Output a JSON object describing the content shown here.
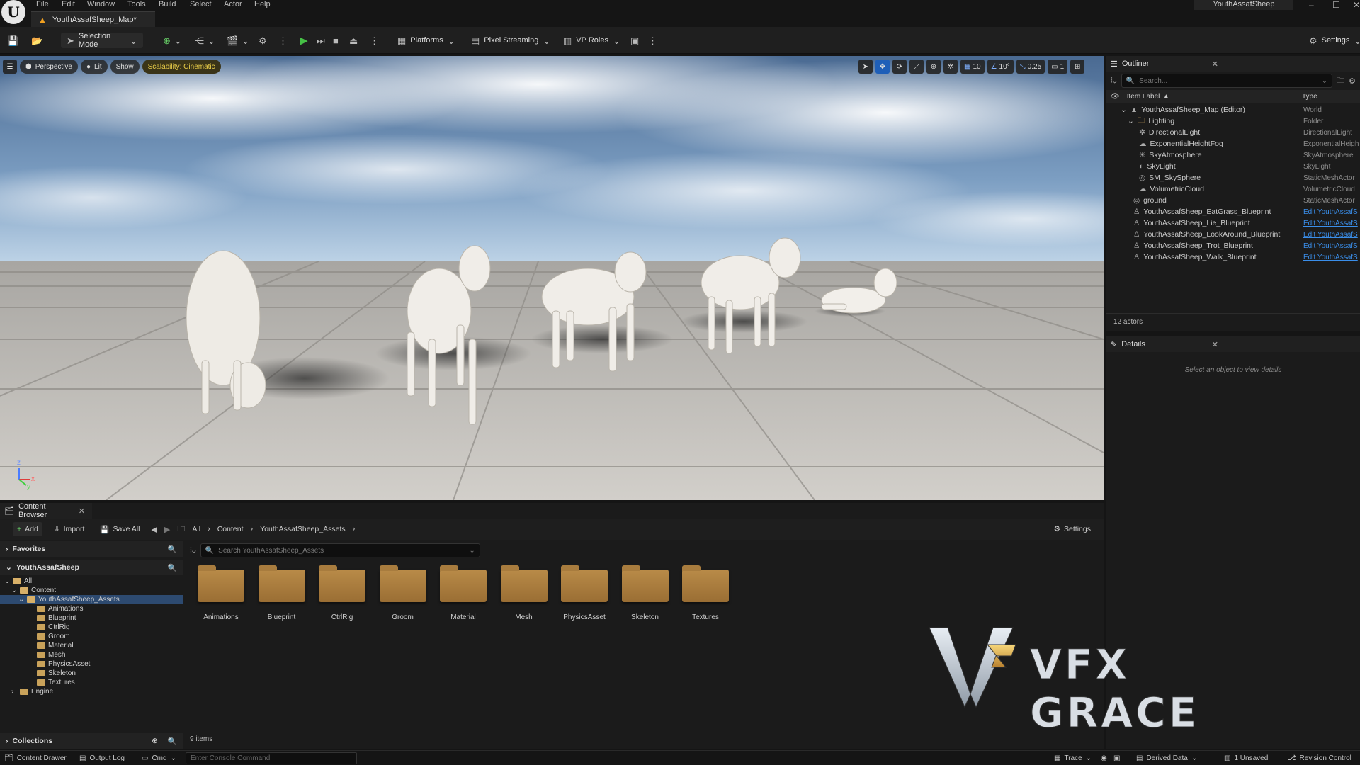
{
  "app": {
    "logo": "U"
  },
  "menu": [
    "File",
    "Edit",
    "Window",
    "Tools",
    "Build",
    "Select",
    "Actor",
    "Help"
  ],
  "tab": {
    "title": "YouthAssafSheep_Map*"
  },
  "project_name": "YouthAssafSheep",
  "toolbar": {
    "selection_mode": "Selection Mode",
    "platforms": "Platforms",
    "pixel_streaming": "Pixel Streaming",
    "vp_roles": "VP Roles",
    "settings": "Settings"
  },
  "viewport": {
    "perspective": "Perspective",
    "lit": "Lit",
    "show": "Show",
    "scalability": "Scalability: Cinematic",
    "grid_snap": "10",
    "rotation_snap": "10°",
    "scale_snap": "0.25",
    "camera_speed": "1",
    "axis_z": "z",
    "axis_x": "x",
    "axis_y": "y"
  },
  "outliner": {
    "title": "Outliner",
    "search_placeholder": "Search...",
    "col_label": "Item Label",
    "col_type": "Type",
    "rows": [
      {
        "label": "YouthAssafSheep_Map (Editor)",
        "type": "World",
        "link": false
      },
      {
        "label": "Lighting",
        "type": "Folder",
        "link": false
      },
      {
        "label": "DirectionalLight",
        "type": "DirectionalLight",
        "link": false
      },
      {
        "label": "ExponentialHeightFog",
        "type": "ExponentialHeigh",
        "link": false
      },
      {
        "label": "SkyAtmosphere",
        "type": "SkyAtmosphere",
        "link": false
      },
      {
        "label": "SkyLight",
        "type": "SkyLight",
        "link": false
      },
      {
        "label": "SM_SkySphere",
        "type": "StaticMeshActor",
        "link": false
      },
      {
        "label": "VolumetricCloud",
        "type": "VolumetricCloud",
        "link": false
      },
      {
        "label": "ground",
        "type": "StaticMeshActor",
        "link": false
      },
      {
        "label": "YouthAssafSheep_EatGrass_Blueprint",
        "type": "Edit YouthAssafS",
        "link": true
      },
      {
        "label": "YouthAssafSheep_Lie_Blueprint",
        "type": "Edit YouthAssafS",
        "link": true
      },
      {
        "label": "YouthAssafSheep_LookAround_Blueprint",
        "type": "Edit YouthAssafS",
        "link": true
      },
      {
        "label": "YouthAssafSheep_Trot_Blueprint",
        "type": "Edit YouthAssafS",
        "link": true
      },
      {
        "label": "YouthAssafSheep_Walk_Blueprint",
        "type": "Edit YouthAssafS",
        "link": true
      }
    ],
    "actor_count": "12 actors"
  },
  "details": {
    "title": "Details",
    "empty_hint": "Select an object to view details"
  },
  "content_browser": {
    "title": "Content Browser",
    "add": "Add",
    "import": "Import",
    "save_all": "Save All",
    "breadcrumb": [
      "All",
      "Content",
      "YouthAssafSheep_Assets"
    ],
    "settings": "Settings",
    "favorites": "Favorites",
    "project": "YouthAssafSheep",
    "collections": "Collections",
    "search_placeholder": "Search YouthAssafSheep_Assets",
    "tree": [
      "All",
      "Content",
      "YouthAssafSheep_Assets",
      "Animations",
      "Blueprint",
      "CtrlRig",
      "Groom",
      "Material",
      "Mesh",
      "PhysicsAsset",
      "Skeleton",
      "Textures",
      "Engine"
    ],
    "folders": [
      "Animations",
      "Blueprint",
      "CtrlRig",
      "Groom",
      "Material",
      "Mesh",
      "PhysicsAsset",
      "Skeleton",
      "Textures"
    ],
    "item_count": "9 items"
  },
  "statusbar": {
    "content_drawer": "Content Drawer",
    "output_log": "Output Log",
    "cmd": "Cmd",
    "console_placeholder": "Enter Console Command",
    "trace": "Trace",
    "derived_data": "Derived Data",
    "unsaved": "1 Unsaved",
    "revision_control": "Revision Control"
  },
  "watermark": {
    "text": "VFX GRACE"
  },
  "colors": {
    "accent": "#1f5fb8",
    "link": "#3a8eea",
    "warning": "#f0a020",
    "play": "#46c046",
    "folder": "#b98b48"
  }
}
